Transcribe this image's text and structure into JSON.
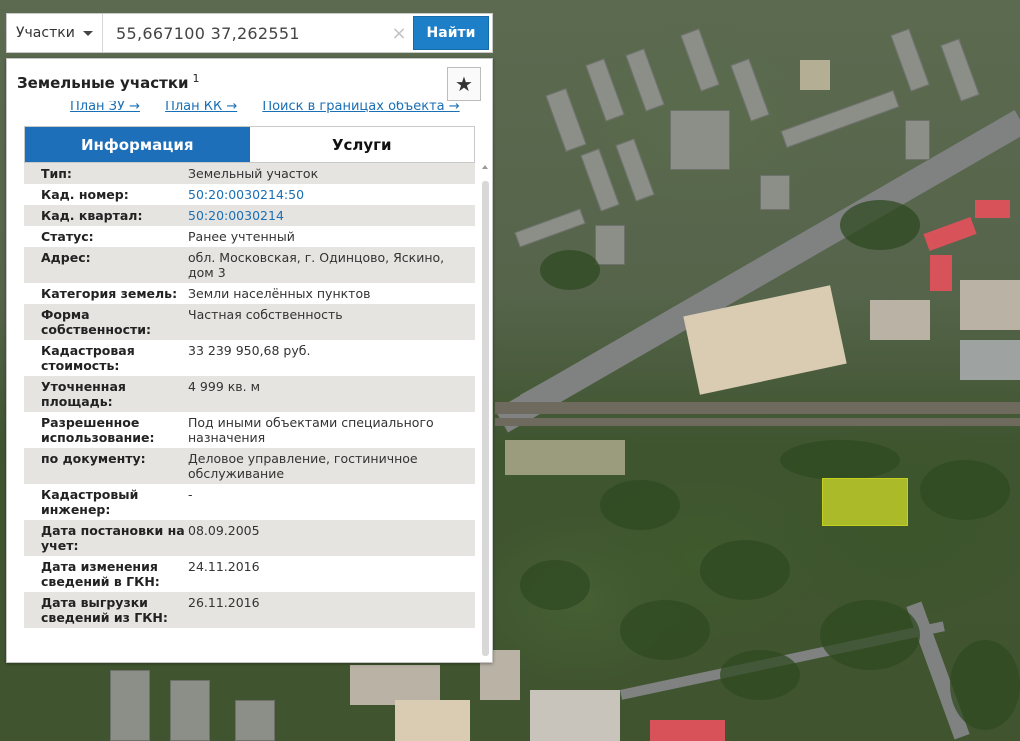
{
  "search": {
    "type_label": "Участки",
    "query": "55,667100 37,262551",
    "clear_symbol": "×",
    "submit_label": "Найти"
  },
  "panel": {
    "title": "Земельные участки",
    "title_superscript": "1",
    "star_symbol": "★",
    "links": [
      "План ЗУ →",
      "План КК →",
      "Поиск в границах объекта →"
    ],
    "tabs": [
      {
        "label": "Информация",
        "active": true
      },
      {
        "label": "Услуги",
        "active": false
      }
    ],
    "rows": [
      {
        "label": "Тип:",
        "value": "Земельный участок",
        "link": false
      },
      {
        "label": "Кад. номер:",
        "value": "50:20:0030214:50",
        "link": true
      },
      {
        "label": "Кад. квартал:",
        "value": "50:20:0030214",
        "link": true
      },
      {
        "label": "Статус:",
        "value": "Ранее учтенный",
        "link": false
      },
      {
        "label": "Адрес:",
        "value": "обл. Московская, г. Одинцово, Яскино, дом 3",
        "link": false
      },
      {
        "label": "Категория земель:",
        "value": "Земли населённых пунктов",
        "link": false
      },
      {
        "label": "Форма собственности:",
        "value": "Частная собственность",
        "link": false
      },
      {
        "label": "Кадастровая стоимость:",
        "value": "33 239 950,68 руб.",
        "link": false
      },
      {
        "label": "Уточненная площадь:",
        "value": "4 999 кв. м",
        "link": false
      },
      {
        "label": "Разрешенное использование:",
        "value": "Под иными объектами специального назначения",
        "link": false
      },
      {
        "label": "по документу:",
        "value": "Деловое управление, гостиничное обслуживание",
        "link": false
      },
      {
        "label": "Кадастровый инженер:",
        "value": "-",
        "link": false
      },
      {
        "label": "Дата постановки на учет:",
        "value": "08.09.2005",
        "link": false
      },
      {
        "label": "Дата изменения сведений в ГКН:",
        "value": "24.11.2016",
        "link": false
      },
      {
        "label": "Дата выгрузки сведений из ГКН:",
        "value": "26.11.2016",
        "link": false
      }
    ]
  },
  "colors": {
    "accent": "#1c6fb8",
    "button": "#1c7fc7",
    "link": "#1b6fb5",
    "highlight_parcel": "#d6e228"
  }
}
